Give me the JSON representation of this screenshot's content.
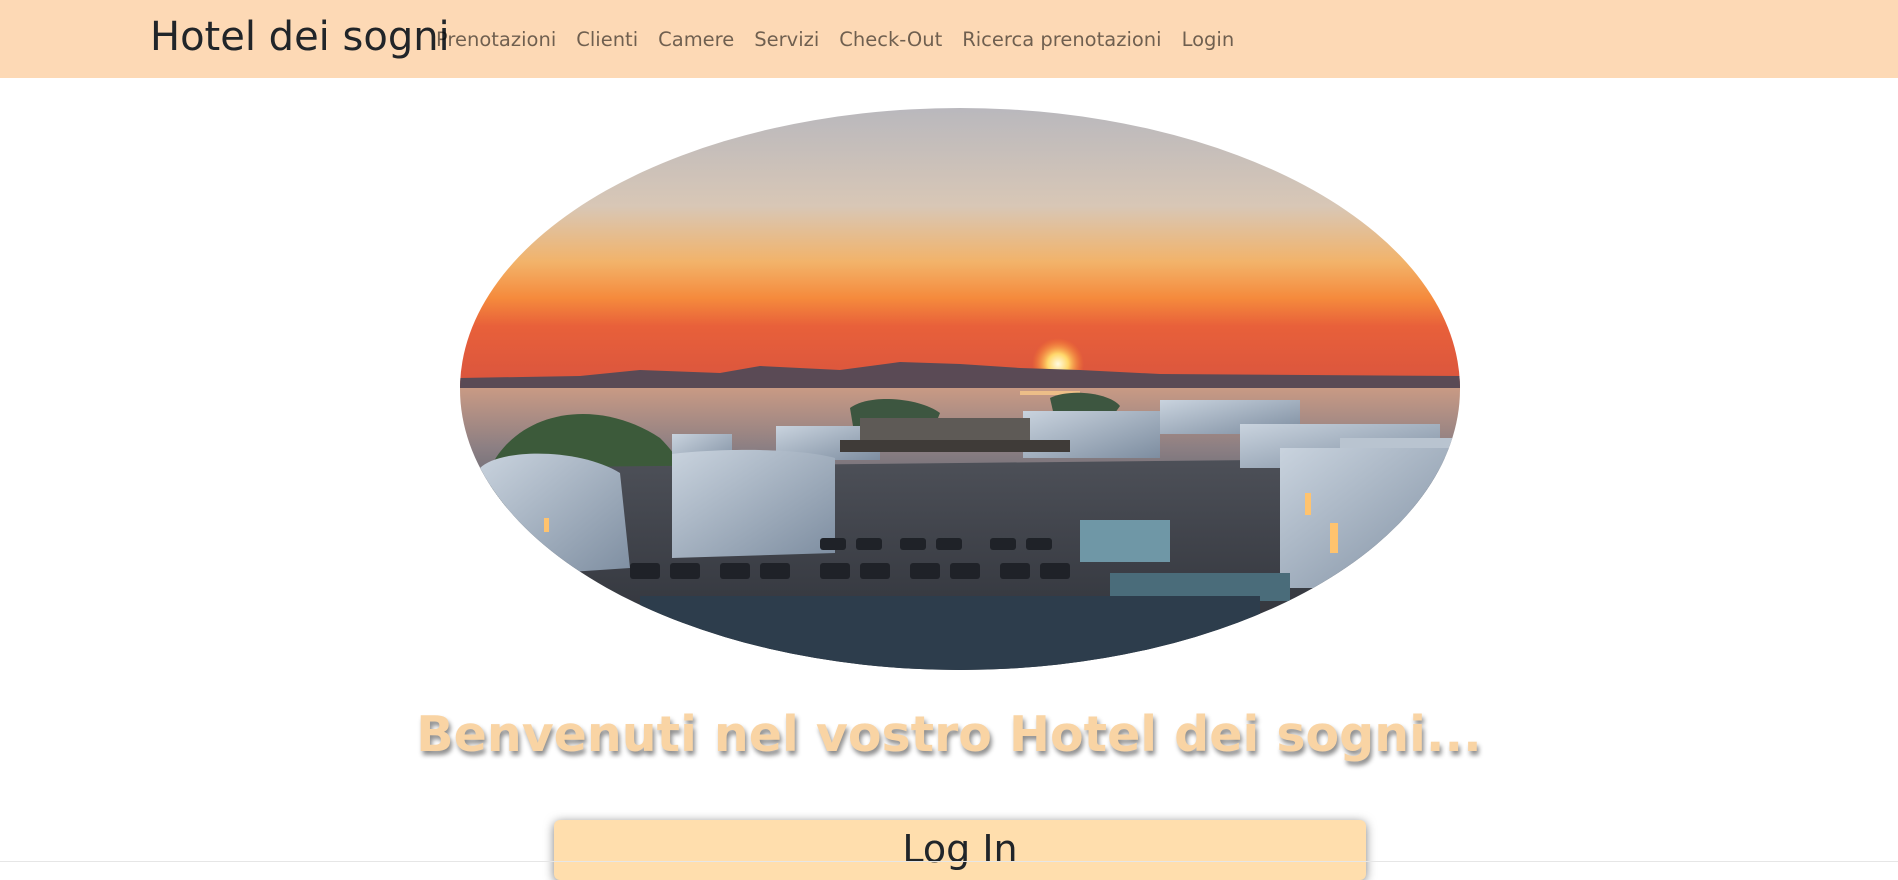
{
  "navbar": {
    "brand": "Hotel dei sogni",
    "links": [
      "Prenotazioni",
      "Clienti",
      "Camere",
      "Servizi",
      "Check-Out",
      "Ricerca prenotazioni",
      "Login"
    ],
    "background_color": "#fdd9b5"
  },
  "hero": {
    "welcome": "Benvenuti nel vostro Hotel dei sogni..."
  },
  "login": {
    "title": "Log In",
    "background_color": "#ffdead"
  }
}
